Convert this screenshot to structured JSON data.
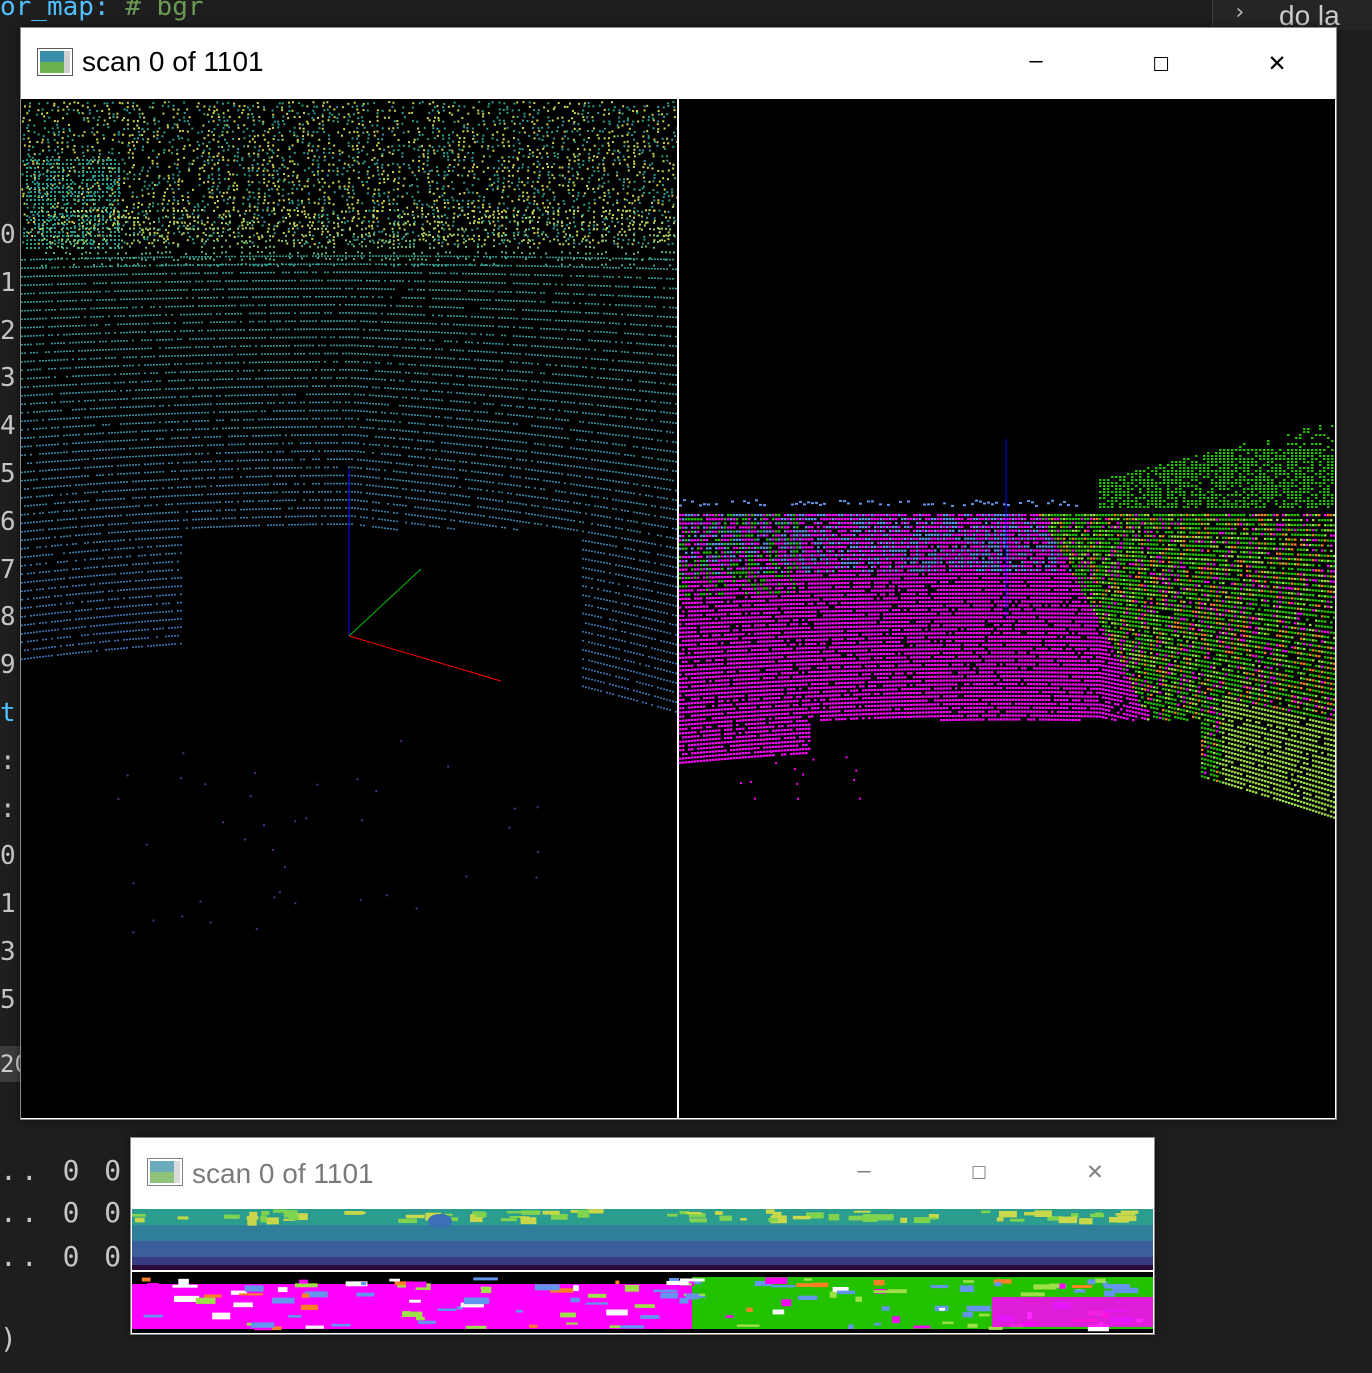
{
  "editor": {
    "code_fragment": "or_map:",
    "code_comment": "# bgr",
    "right_tab_label": "do la",
    "line_numbers": [
      "0",
      "1",
      "2",
      "3",
      "4",
      "5",
      "6",
      "7",
      "8",
      "9",
      "t",
      ":",
      ":",
      "0",
      "1",
      "3",
      "5"
    ],
    "selected_line": "20",
    "bottom_lines": [
      ".. 0 0 0",
      ".. 0 0",
      ".. 0 0",
      ")"
    ]
  },
  "main_window": {
    "title": "scan 0 of 1101",
    "icon": "opencv-window-icon",
    "controls": {
      "minimize": "—",
      "maximize": "☐",
      "close": "✕"
    },
    "left_pane": "point-cloud-range-view",
    "right_pane": "point-cloud-semantic-view"
  },
  "second_window": {
    "title": "scan 0 of 1101",
    "icon": "opencv-window-icon",
    "controls": {
      "minimize": "—",
      "maximize": "☐",
      "close": "✕"
    },
    "top_strip": "range-image-strip",
    "bottom_strip": "semantic-image-strip"
  },
  "colors": {
    "editor_bg": "#1e1e1e",
    "range_teal": "#2a9d8f",
    "range_blue": "#3b6fb6",
    "range_yellow": "#c8d84a",
    "semantic_magenta": "#ff00ff",
    "semantic_green": "#22c200",
    "semantic_lime": "#9ee04a",
    "semantic_blue": "#6495ed",
    "semantic_orange": "#ff7f27"
  }
}
